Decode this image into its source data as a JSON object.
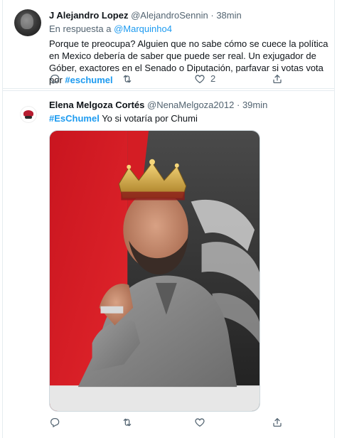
{
  "tweet1": {
    "display_name": "J Alejandro Lopez",
    "handle": "@AlejandroSennin",
    "separator": "·",
    "time": "38min",
    "reply_prefix": "En respuesta a",
    "reply_to": "@Marquinho4",
    "text": "Porque te preocupa? Alguien que no sabe cómo se cuece la política en Mexico debería de saber que puede ser real. Un exjugador de Góber, exactores en el Senado o Diputación, parfavar si votas vota por ",
    "hashtag": "#eschumel",
    "like_count": "2"
  },
  "tweet2": {
    "display_name": "Elena Melgoza Cortés",
    "handle": "@NenaMelgoza2012",
    "separator": "·",
    "time": "39min",
    "hashtag": "#EsChumel",
    "text": " Yo si votaría por Chumi"
  },
  "icons": {
    "reply": "reply-icon",
    "retweet": "retweet-icon",
    "like": "heart-icon",
    "share": "share-icon"
  },
  "colors": {
    "link": "#1d9bf0",
    "secondary_text": "#536471",
    "primary_text": "#0f1419"
  }
}
